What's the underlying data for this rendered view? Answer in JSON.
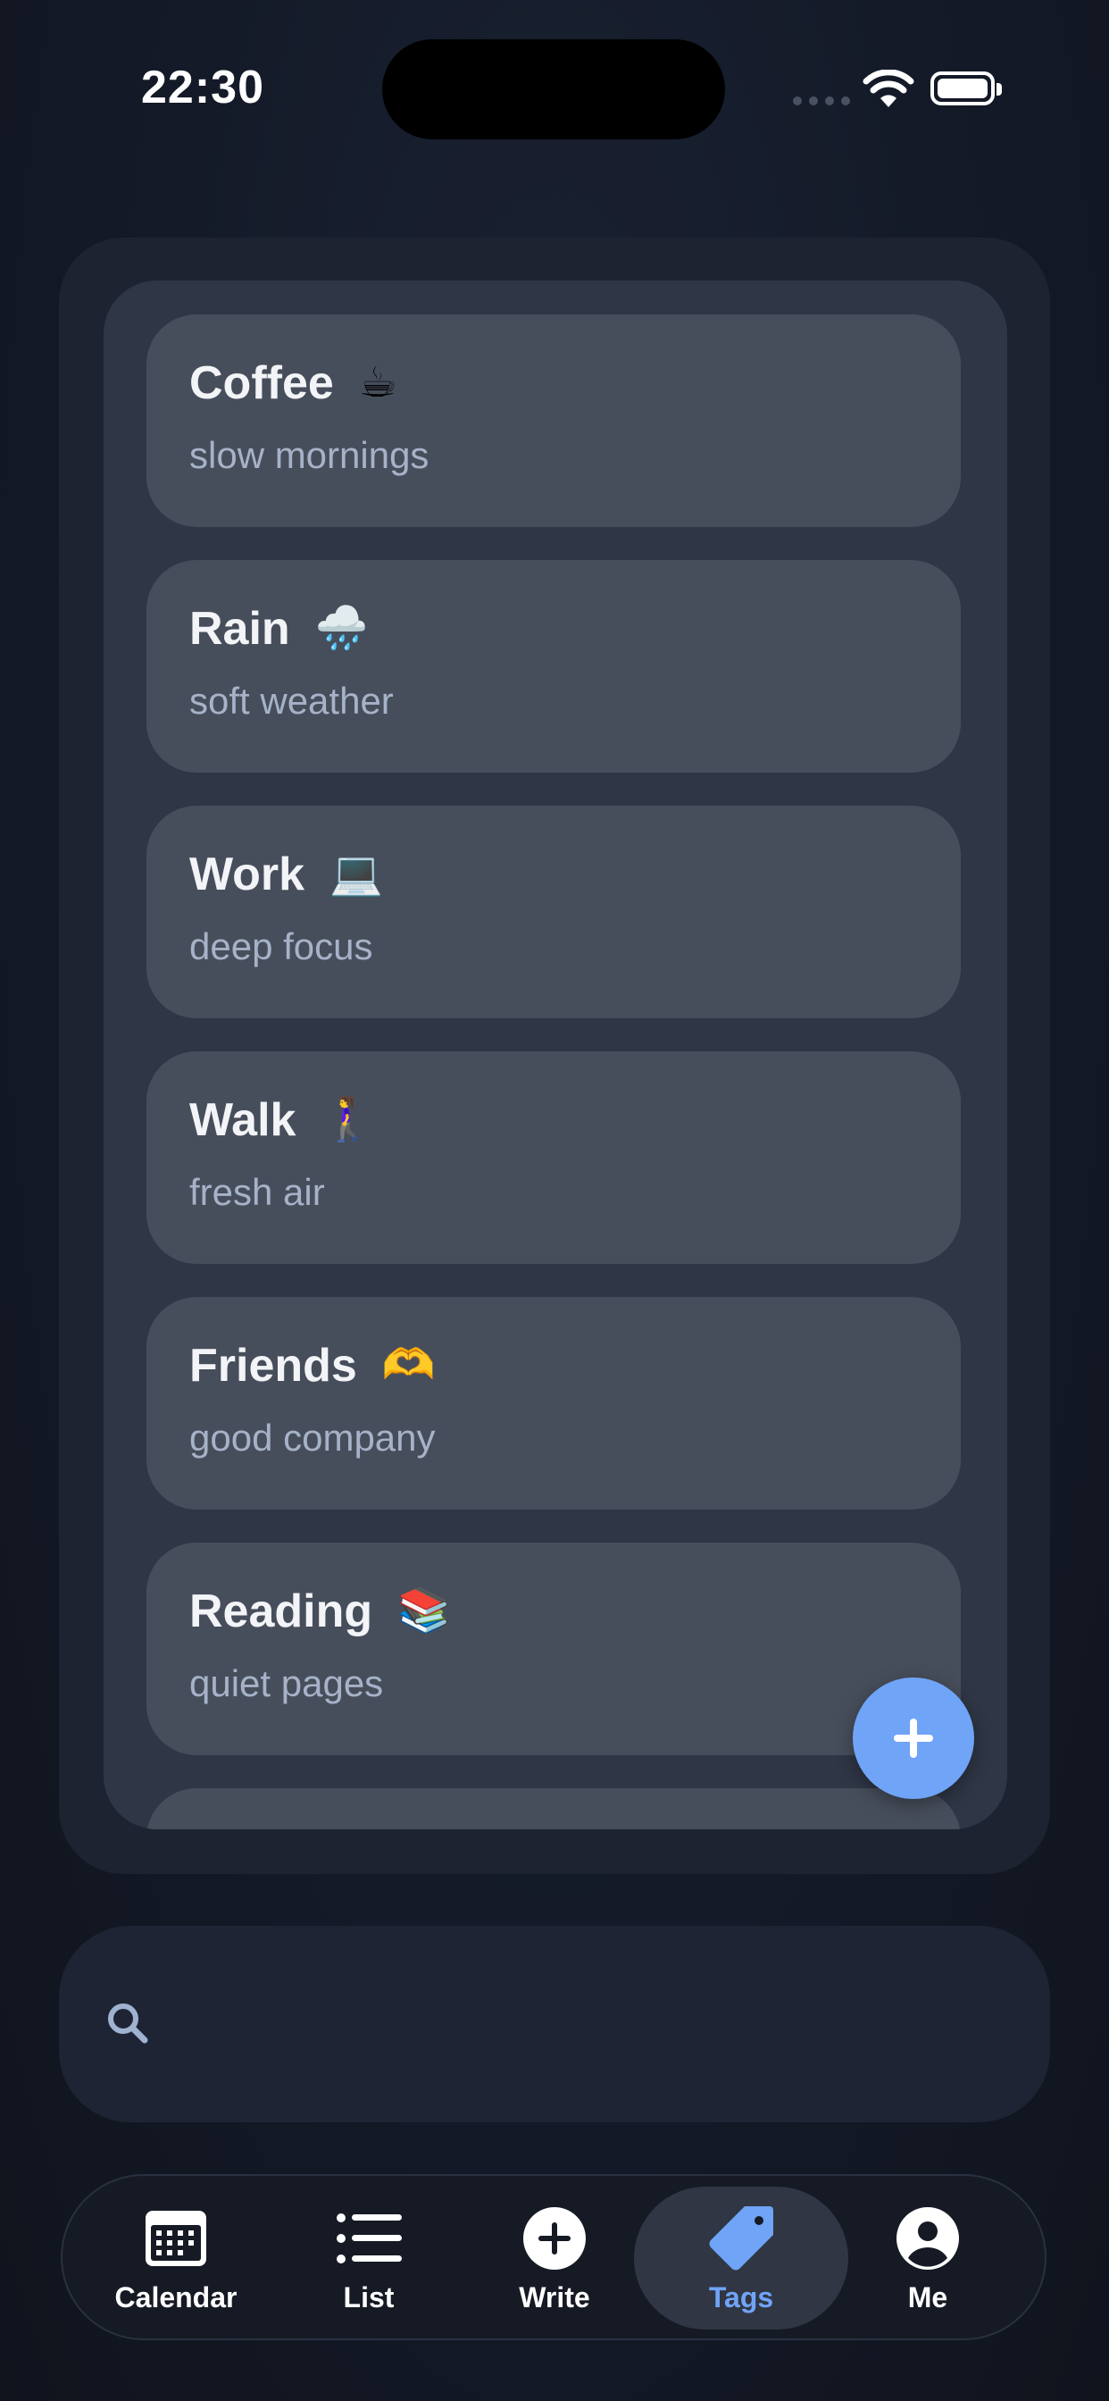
{
  "status_bar": {
    "time": "22:30"
  },
  "tags": [
    {
      "name": "Coffee",
      "emoji": "☕",
      "description": "slow mornings"
    },
    {
      "name": "Rain",
      "emoji": "🌧️",
      "description": "soft weather"
    },
    {
      "name": "Work",
      "emoji": "💻",
      "description": "deep focus"
    },
    {
      "name": "Walk",
      "emoji": "🚶‍♀️",
      "description": "fresh air"
    },
    {
      "name": "Friends",
      "emoji": "🫶",
      "description": "good company"
    },
    {
      "name": "Reading",
      "emoji": "📚",
      "description": "quiet pages"
    }
  ],
  "fab": {
    "icon": "plus-icon"
  },
  "search": {
    "placeholder": "",
    "value": "",
    "icon": "search-icon"
  },
  "tab_bar": {
    "active": "Tags",
    "tabs": [
      {
        "label": "Calendar",
        "icon": "calendar-icon"
      },
      {
        "label": "List",
        "icon": "list-icon"
      },
      {
        "label": "Write",
        "icon": "plus-circle-icon"
      },
      {
        "label": "Tags",
        "icon": "tag-icon"
      },
      {
        "label": "Me",
        "icon": "person-icon"
      }
    ]
  },
  "colors": {
    "accent": "#6fa4f7",
    "background": "#141a26",
    "card": "#474e5b",
    "panel": "#2f3645"
  }
}
